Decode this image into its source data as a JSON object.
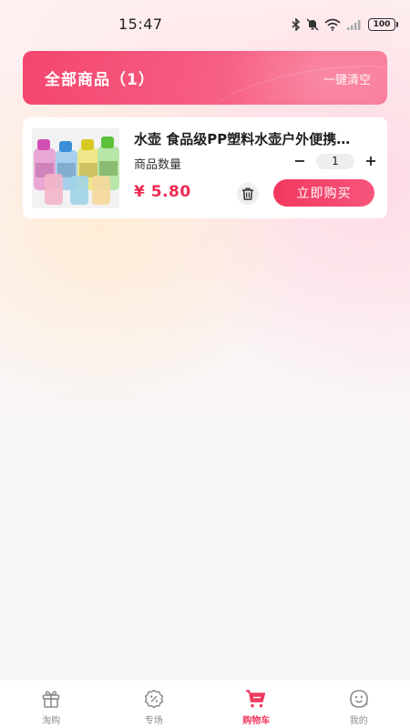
{
  "status_bar": {
    "time": "15:47",
    "battery": "100",
    "icons": [
      "bluetooth-icon",
      "mute-icon",
      "wifi-icon",
      "signal-icon",
      "battery-icon"
    ]
  },
  "header": {
    "title": "全部商品（1）",
    "clear_label": "一键清空"
  },
  "cart": {
    "items": [
      {
        "name": "水壶 食品级PP塑料水壶户外便携…",
        "qty_label": "商品数量",
        "quantity": "1",
        "price": "¥ 5.80",
        "buy_label": "立即购买",
        "thumbnail_icon": "water-bottle-image"
      }
    ]
  },
  "tabs": [
    {
      "label": "淘购",
      "icon": "gift-icon",
      "active": false
    },
    {
      "label": "专场",
      "icon": "discount-badge-icon",
      "active": false
    },
    {
      "label": "购物车",
      "icon": "cart-icon",
      "active": true
    },
    {
      "label": "我的",
      "icon": "profile-icon",
      "active": false
    }
  ],
  "colors": {
    "accent": "#ef3a5f",
    "price": "#ee2a52",
    "banner_start": "#f4466e",
    "banner_end": "#f97a99",
    "tab_inactive": "#8c8c8c"
  }
}
